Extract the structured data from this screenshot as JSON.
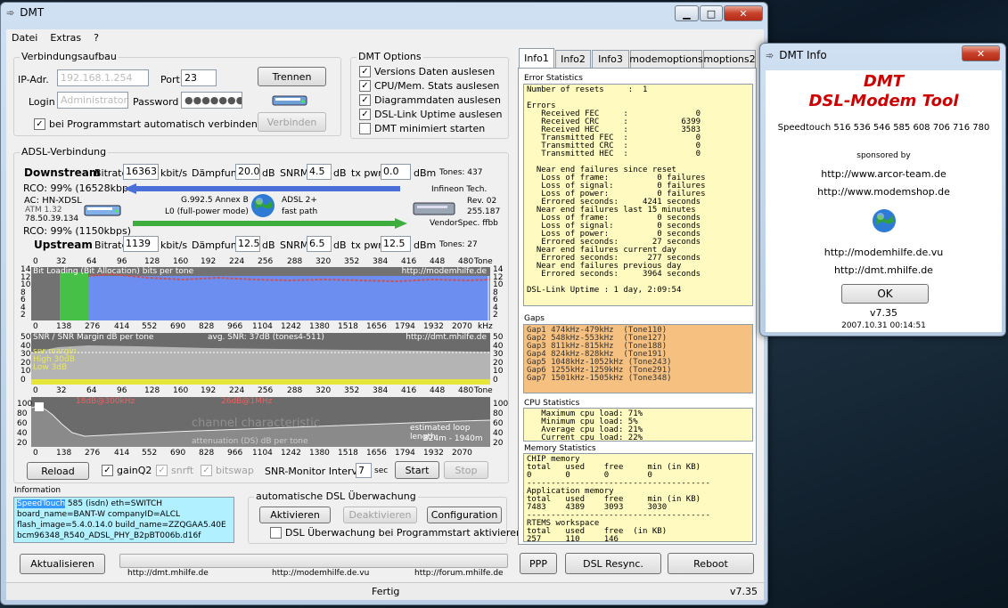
{
  "main_window": {
    "title": "DMT",
    "controls": {
      "minimize": "▁",
      "maximize": "□",
      "close": "✕"
    },
    "menu": [
      "Datei",
      "Extras",
      "?"
    ],
    "conn": {
      "group": "Verbindungsaufbau",
      "ip_label": "IP-Adr.",
      "ip_value": "192.168.1.254",
      "port_label": "Port",
      "port_value": "23",
      "login_label": "Login",
      "login_value": "Administrator",
      "password_label": "Password",
      "password_value": "●●●●●●●",
      "disconnect": "Trennen",
      "connect": "Verbinden",
      "autoconnect": "bei Programmstart automatisch verbinden"
    },
    "options": {
      "group": "DMT Options",
      "items": [
        {
          "label": "Versions Daten auslesen",
          "checked": true
        },
        {
          "label": "CPU/Mem. Stats auslesen",
          "checked": true
        },
        {
          "label": "Diagrammdaten auslesen",
          "checked": true
        },
        {
          "label": "DSL-Link Uptime auslesen",
          "checked": true
        },
        {
          "label": "DMT minimiert starten",
          "checked": false
        }
      ]
    },
    "adsl": {
      "group": "ADSL-Verbindung",
      "ds_label": "Downstream",
      "us_label": "Upstream",
      "bitrate_label": "Bitrate",
      "kbit": "kbit/s",
      "daempfung": "Dämpfung",
      "db": "dB",
      "snrm": "SNRM",
      "txpwr": "tx pwr",
      "dbm": "dBm",
      "ds": {
        "bitrate": "16363",
        "att": "20.0",
        "snrm": "4.5",
        "txpwr": "0.0",
        "tones": "Tones: 437",
        "rco": "RCO: 99% (16528kbps)"
      },
      "us": {
        "bitrate": "1139",
        "att": "12.5",
        "snrm": "6.5",
        "txpwr": "12.5",
        "tones": "Tones: 27",
        "rco": "RCO: 99% (1150kbps)"
      },
      "ac": "AC: HN-XDSL",
      "atm": "ATM 1.32",
      "ip": "78.50.39.134",
      "mode": "G.992.5 Annex B",
      "l0": "L0 (full-power mode)",
      "proto": "ADSL 2+",
      "path": "fast path",
      "vendor": "Infineon Tech.",
      "rev": "Rev. 02",
      "rev_num": "255.187",
      "vendorspec": "VendorSpec. ffbb"
    },
    "graph1": {
      "title": "Bit Loading (Bit Allocation)   bits per tone",
      "url": "http://modemhilfe.de",
      "top_ticks": [
        "0",
        "32",
        "64",
        "96",
        "128",
        "160",
        "192",
        "224",
        "256",
        "288",
        "320",
        "352",
        "384",
        "416",
        "448",
        "480",
        "Tone"
      ],
      "bottom_ticks": [
        "0",
        "138",
        "276",
        "414",
        "552",
        "690",
        "828",
        "966",
        "1104",
        "1242",
        "1380",
        "1518",
        "1656",
        "1794",
        "1932",
        "2070",
        "kHz"
      ],
      "y": [
        "14",
        "12",
        "10",
        "8",
        "6",
        "4",
        "2",
        "0"
      ]
    },
    "graph2": {
      "title": "SNR / SNR Margin  dB per tone",
      "avg": "avg. SNR: 37dB  (tones4-511)",
      "url": "http://dmt.mhilfe.de",
      "legend": [
        "snr margin",
        "High 30dB",
        "Low  3dB"
      ],
      "y": [
        "50",
        "40",
        "30",
        "20",
        "10",
        "0"
      ]
    },
    "graph3": {
      "marker1": "18dB@300kHz",
      "marker2": "26dB@1MHz",
      "watermark": "channel characteristic",
      "subtitle": "attenuation (DS)   dB per tone",
      "est": "estimated loop length",
      "est_val": "824m - 1940m",
      "y": [
        "100",
        "80",
        "60",
        "40",
        "20"
      ]
    },
    "bottom": {
      "reload": "Reload",
      "gainq2": "gainQ2",
      "snrft": "snrft",
      "bitswap": "bitswap",
      "interval_label": "SNR-Monitor Interval:",
      "interval": "7",
      "sec": "sec",
      "start": "Start",
      "stop": "Stop"
    },
    "info": {
      "label": "Information",
      "lines": [
        {
          "hl": "SpeedTouch",
          "rest": "585 (isdn) eth=SWITCH"
        },
        {
          "hl": "",
          "rest": "board_name=BANT-W   companyID=ALCL"
        },
        {
          "hl": "",
          "rest": "flash_image=5.4.0.14.0  build_name=ZZQGAA5.40E"
        },
        {
          "hl": "",
          "rest": "bcm96348_R540_ADSL_PHY_B2pBT006b.d16f"
        }
      ]
    },
    "monitor": {
      "group": "automatische DSL Überwachung",
      "activate": "Aktivieren",
      "deactivate": "Deaktivieren",
      "config": "Configuration",
      "auto": "DSL Überwachung bei Programmstart aktivieren"
    },
    "refresh": "Aktualisieren",
    "links": [
      "http://dmt.mhilfe.de",
      "http://modemhilfe.de.vu",
      "http://forum.mhilfe.de"
    ],
    "ppp": "PPP",
    "resync": "DSL Resync.",
    "reboot": "Reboot",
    "status": "Fertig",
    "version": "v7.35",
    "tabs": [
      "Info1",
      "Info2",
      "Info3",
      "modemoptions",
      "moptions2"
    ],
    "error_stats": {
      "heading": "Error Statistics",
      "text": "Number of resets     :  1\n\nErrors\n   Received FEC     :              0\n   Received CRC     :           6399\n   Received HEC     :           3583\n   Transmitted FEC  :              0\n   Transmitted CRC  :              0\n   Transmitted HEC  :              0\n\n  Near end failures since reset\n   Loss of frame:          0 failures\n   Loss of signal:         0 failures\n   Loss of power:          0 failures\n   Errored seconds:     4241 seconds\n  Near end failures last 15 minutes\n   Loss of frame:          0 seconds\n   Loss of signal:         0 seconds\n   Loss of power:          0 seconds\n   Errored seconds:       27 seconds\n  Near end failures current day\n   Errored seconds:      277 seconds\n  Near end failures previous day\n   Errored seconds:     3964 seconds\n\nDSL-Link Uptime : 1 day, 2:09:54"
    },
    "gaps": {
      "heading": "Gaps",
      "text": "Gap1 474kHz-479kHz  (Tone110)\nGap2 548kHz-553kHz  (Tone127)\nGap3 811kHz-815kHz  (Tone188)\nGap4 824kHz-828kHz  (Tone191)\nGap5 1048kHz-1052kHz (Tone243)\nGap6 1255kHz-1259kHz (Tone291)\nGap7 1501kHz-1505kHz (Tone348)"
    },
    "cpu": {
      "heading": "CPU Statistics",
      "text": "   Maximum cpu load: 71%\n   Minimum cpu load: 5%\n   Average cpu load: 21%\n   Current cpu load: 22%"
    },
    "mem": {
      "heading": "Memory Statistics",
      "text": "CHIP memory\ntotal   used    free     min (in KB)\n0       0       0        0\n--------------------------------------\nApplication memory\ntotal   used    free     min (in KB)\n7483    4389    3093     3030\n--------------------------------------\nRTEMS workspace\ntotal   used    free  (in KB)\n257     110     146"
    }
  },
  "info_window": {
    "title": "DMT Info",
    "close": "✕",
    "app": "DMT",
    "app_full": "DSL-Modem Tool",
    "supported": "Speedtouch 516 536 546 585 608 706 716 780",
    "sponsored": "sponsored by",
    "link1": "http://www.arcor-team.de",
    "link2": "http://www.modemshop.de",
    "link3": "http://modemhilfe.de.vu",
    "link4": "http://dmt.mhilfe.de",
    "ok": "OK",
    "version": "v7.35",
    "date": "2007.10.31 00:14:51"
  },
  "colors": {
    "accent_red": "#cc0000",
    "bitload_blue": "#5b7fe8",
    "green": "#4caf50",
    "snr_gray": "#b0b0b0",
    "info_yellow": "#fffbc0",
    "gaps_orange": "#f5c080",
    "info_cyan": "#b0f0ff"
  }
}
